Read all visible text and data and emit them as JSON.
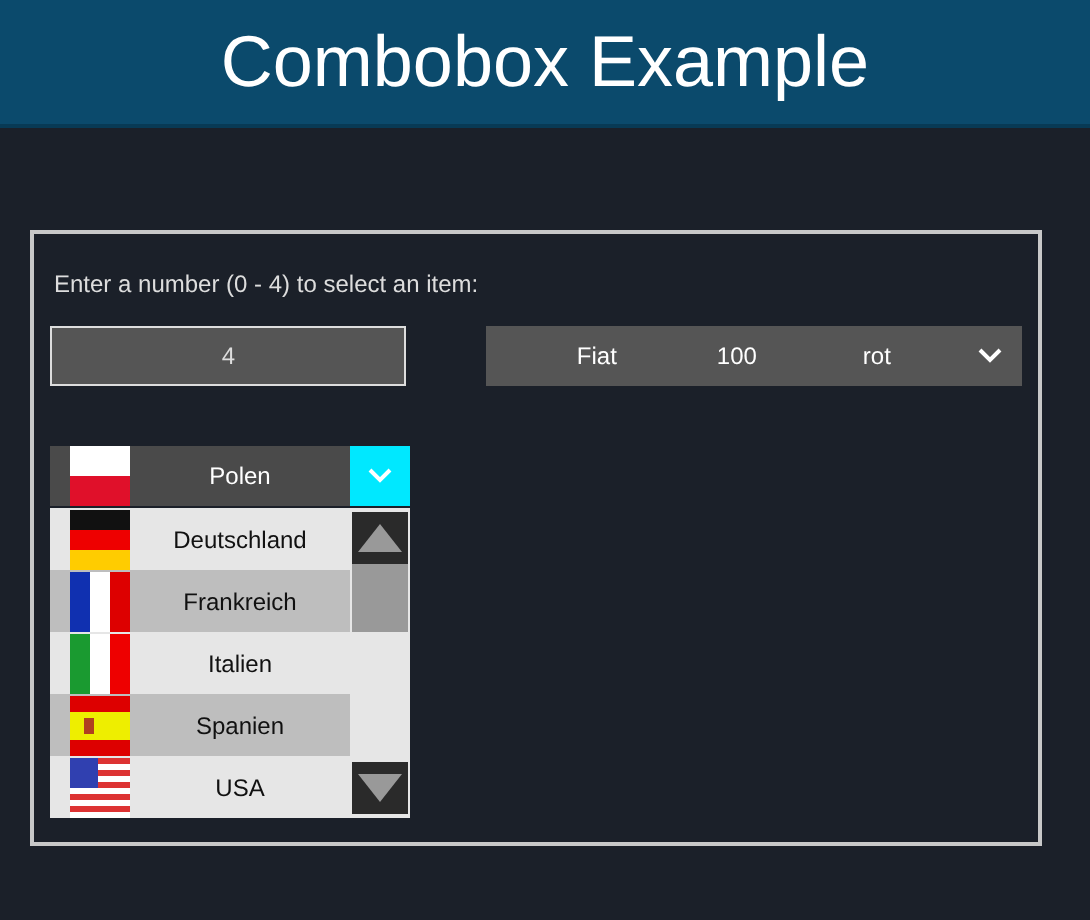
{
  "header": {
    "title": "Combobox Example"
  },
  "prompt": "Enter a number (0 - 4) to select an item:",
  "number_field": {
    "value": "4"
  },
  "car_combobox": {
    "columns": [
      "Fiat",
      "100",
      "rot"
    ],
    "expanded": false
  },
  "country_combobox": {
    "value": "Polen",
    "expanded": true,
    "items": [
      {
        "label": "Deutschland"
      },
      {
        "label": "Frankreich"
      },
      {
        "label": "Italien"
      },
      {
        "label": "Spanien"
      },
      {
        "label": "USA"
      }
    ]
  }
}
